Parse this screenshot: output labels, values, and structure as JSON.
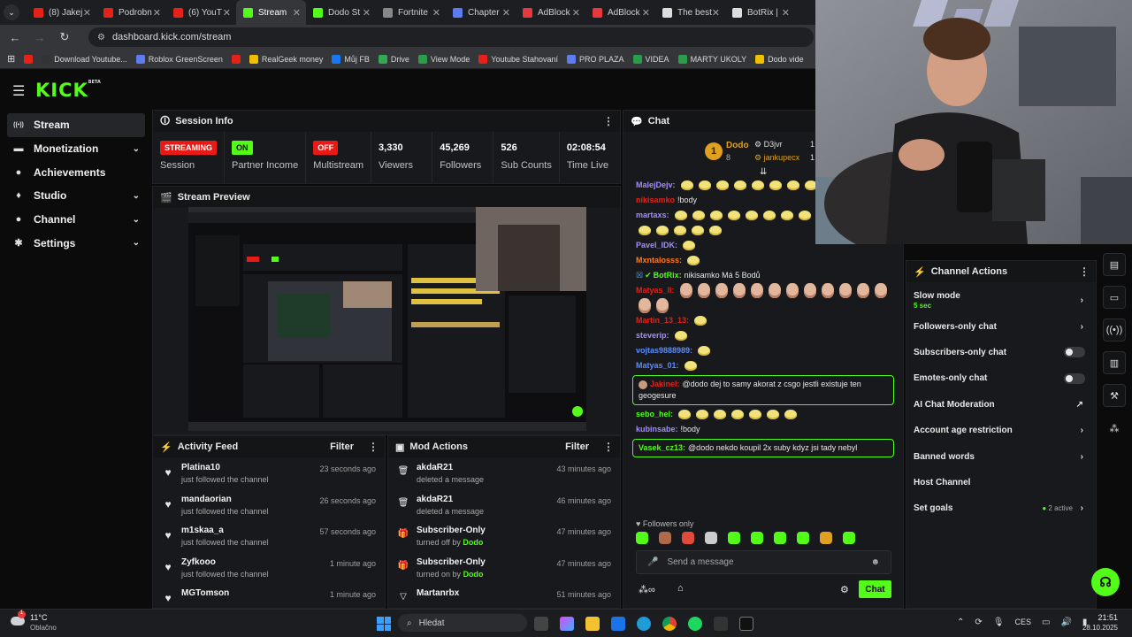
{
  "browser": {
    "tabs": [
      {
        "label": "(8) Jakej",
        "color": "#e62117"
      },
      {
        "label": "Podrobn",
        "color": "#e62117"
      },
      {
        "label": "(6) YouT",
        "color": "#e62117"
      },
      {
        "label": "Stream",
        "color": "#53fc18",
        "active": true
      },
      {
        "label": "Dodo St",
        "color": "#53fc18"
      },
      {
        "label": "Fortnite",
        "color": "#888888"
      },
      {
        "label": "Chapter",
        "color": "#5d7cf2"
      },
      {
        "label": "AdBlock",
        "color": "#e5393e"
      },
      {
        "label": "AdBlock",
        "color": "#e5393e"
      },
      {
        "label": "The best",
        "color": "#dddddd"
      },
      {
        "label": "BotRix |",
        "color": "#dddddd"
      }
    ],
    "url": "dashboard.kick.com/stream",
    "bookmarks": [
      {
        "label": "",
        "color": "#e62117"
      },
      {
        "label": "Download Youtube...",
        "color": "#333333"
      },
      {
        "label": "Roblox GreenScreen",
        "color": "#5d7cf2"
      },
      {
        "label": "",
        "color": "#e62117"
      },
      {
        "label": "RealGeek money",
        "color": "#f0c000"
      },
      {
        "label": "Můj FB",
        "color": "#1877f2"
      },
      {
        "label": "Drive",
        "color": "#34a853"
      },
      {
        "label": "View Mode",
        "color": "#2a9d4b"
      },
      {
        "label": "Youtube Stahovaní",
        "color": "#e62117"
      },
      {
        "label": "PRO PLAZA",
        "color": "#5d7cf2"
      },
      {
        "label": "VIDEA",
        "color": "#2a9d4b"
      },
      {
        "label": "MARTY UKOLY",
        "color": "#2a9d4b"
      },
      {
        "label": "Dodo vide",
        "color": "#f0c000"
      }
    ]
  },
  "kick": {
    "logo": "KICK",
    "logo_sup": "BETA",
    "sidebar": [
      {
        "label": "Stream",
        "icon": "stream-icon",
        "glyph": "((•))",
        "active": true,
        "chevron": false
      },
      {
        "label": "Monetization",
        "icon": "dollar-icon",
        "glyph": "▬",
        "chevron": true
      },
      {
        "label": "Achievements",
        "icon": "bulb-icon",
        "glyph": "●",
        "chevron": false
      },
      {
        "label": "Studio",
        "icon": "studio-icon",
        "glyph": "♦",
        "chevron": true
      },
      {
        "label": "Channel",
        "icon": "user-icon",
        "glyph": "●",
        "chevron": true
      },
      {
        "label": "Settings",
        "icon": "gear-icon",
        "glyph": "✱",
        "chevron": true
      }
    ],
    "session": {
      "title": "Session Info",
      "stats": [
        {
          "badge": "STREAMING",
          "badge_type": "red",
          "label": "Session"
        },
        {
          "badge": "ON",
          "badge_type": "green",
          "label": "Partner Income"
        },
        {
          "badge": "OFF",
          "badge_type": "red",
          "label": "Multistream"
        },
        {
          "value": "3,330",
          "label": "Viewers"
        },
        {
          "value": "45,269",
          "label": "Followers"
        },
        {
          "value": "526",
          "label": "Sub Counts"
        },
        {
          "value": "02:08:54",
          "label": "Time Live"
        }
      ]
    },
    "preview": {
      "title": "Stream Preview"
    },
    "activity": {
      "title": "Activity Feed",
      "filter": "Filter",
      "items": [
        {
          "name": "Platina10",
          "sub": "just followed the channel",
          "time": "23 seconds ago"
        },
        {
          "name": "mandaorian",
          "sub": "just followed the channel",
          "time": "26 seconds ago"
        },
        {
          "name": "m1skaa_a",
          "sub": "just followed the channel",
          "time": "57 seconds ago"
        },
        {
          "name": "Zyfkooo",
          "sub": "just followed the channel",
          "time": "1 minute ago"
        },
        {
          "name": "MGTomson",
          "sub": "",
          "time": "1 minute ago"
        }
      ]
    },
    "mod": {
      "title": "Mod Actions",
      "filter": "Filter",
      "items": [
        {
          "name": "akdaR21",
          "sub": "deleted a message",
          "by": "",
          "time": "43 minutes ago",
          "icon": "trash-icon",
          "glyph": "🗑"
        },
        {
          "name": "akdaR21",
          "sub": "deleted a message",
          "by": "",
          "time": "46 minutes ago",
          "icon": "trash-icon",
          "glyph": "🗑"
        },
        {
          "name": "Subscriber-Only",
          "sub": "turned off by",
          "by": "Dodo",
          "time": "47 minutes ago",
          "icon": "gift-icon",
          "glyph": "🎁"
        },
        {
          "name": "Subscriber-Only",
          "sub": "turned on by",
          "by": "Dodo",
          "time": "47 minutes ago",
          "icon": "gift-icon",
          "glyph": "🎁"
        },
        {
          "name": "Martanrbx",
          "sub": "",
          "by": "",
          "time": "51 minutes ago",
          "icon": "shield-icon",
          "glyph": "▽"
        }
      ]
    },
    "chat": {
      "title": "Chat",
      "leaderboard": {
        "rank": "1",
        "name": "Dodo",
        "count": "8",
        "user2": "D3jvr",
        "user2_count": "1",
        "user3": "jankupecx",
        "user3_count": "1"
      },
      "messages": [
        {
          "user": "MalejDejv:",
          "color": "#a58bff",
          "text": "",
          "emotes": 10,
          "type": "emo"
        },
        {
          "user": "nikisamko",
          "color": "#e62117",
          "text": "!body",
          "emotes": 0,
          "type": "text"
        },
        {
          "user": "martaxs:",
          "color": "#a58bff",
          "text": "",
          "emotes": 17,
          "type": "emo"
        },
        {
          "user": "Pavel_IDK:",
          "color": "#a58bff",
          "text": "",
          "emotes": 1,
          "type": "emo"
        },
        {
          "user": "Mxntalosss:",
          "color": "#ff7a1a",
          "text": "",
          "emotes": 1,
          "type": "emo"
        },
        {
          "user": "BotRix:",
          "color": "#53fc18",
          "text": "nikisamko Má 5 Bodů",
          "emotes": 0,
          "type": "bot"
        },
        {
          "user": "Matyas_ll:",
          "color": "#e62117",
          "text": "",
          "emotes": 14,
          "type": "face"
        },
        {
          "user": "Martin_13_13:",
          "color": "#e62117",
          "text": "",
          "emotes": 1,
          "type": "emo"
        },
        {
          "user": "steverip:",
          "color": "#a58bff",
          "text": "",
          "emotes": 1,
          "type": "emo"
        },
        {
          "user": "vojtas9888989:",
          "color": "#5b8cff",
          "text": "",
          "emotes": 1,
          "type": "emo"
        },
        {
          "user": "Matyas_01:",
          "color": "#5b8cff",
          "text": "",
          "emotes": 1,
          "type": "emo"
        }
      ],
      "highlight1": {
        "user": "Jakinel:",
        "color": "#e62117",
        "text": "@dodo dej to samy akorat z csgo jestli existuje ten geogesure"
      },
      "after": [
        {
          "user": "sebo_hel:",
          "color": "#53fc18",
          "text": "",
          "emotes": 7,
          "type": "emo"
        },
        {
          "user": "kubinsabe:",
          "color": "#a58bff",
          "text": "!body",
          "emotes": 0,
          "type": "text"
        }
      ],
      "highlight2": {
        "user": "Vasek_cz13:",
        "color": "#53fc18",
        "text": "@dodo nekdo koupil 2x suby kdyz jsi tady nebyl"
      },
      "followers_only": "Followers only",
      "placeholder": "Send a message",
      "send": "Chat"
    },
    "channel_actions": {
      "title": "Channel Actions",
      "rows": [
        {
          "label": "Slow mode",
          "sub": "5 sec",
          "kind": "chevron"
        },
        {
          "label": "Followers-only chat",
          "kind": "chevron"
        },
        {
          "label": "Subscribers-only chat",
          "kind": "toggle"
        },
        {
          "label": "Emotes-only chat",
          "kind": "toggle"
        },
        {
          "label": "AI Chat Moderation",
          "kind": "external"
        },
        {
          "label": "Account age restriction",
          "kind": "chevron"
        },
        {
          "label": "Banned words",
          "kind": "chevron"
        },
        {
          "label": "Host Channel",
          "kind": "none"
        },
        {
          "label": "Set goals",
          "kind": "goals",
          "extra": "2 active"
        }
      ]
    }
  },
  "taskbar": {
    "weather_temp": "11°C",
    "weather_desc": "Oblačno",
    "search": "Hledat",
    "lang": "CES",
    "time": "21:51",
    "date": "28.10.2025"
  }
}
